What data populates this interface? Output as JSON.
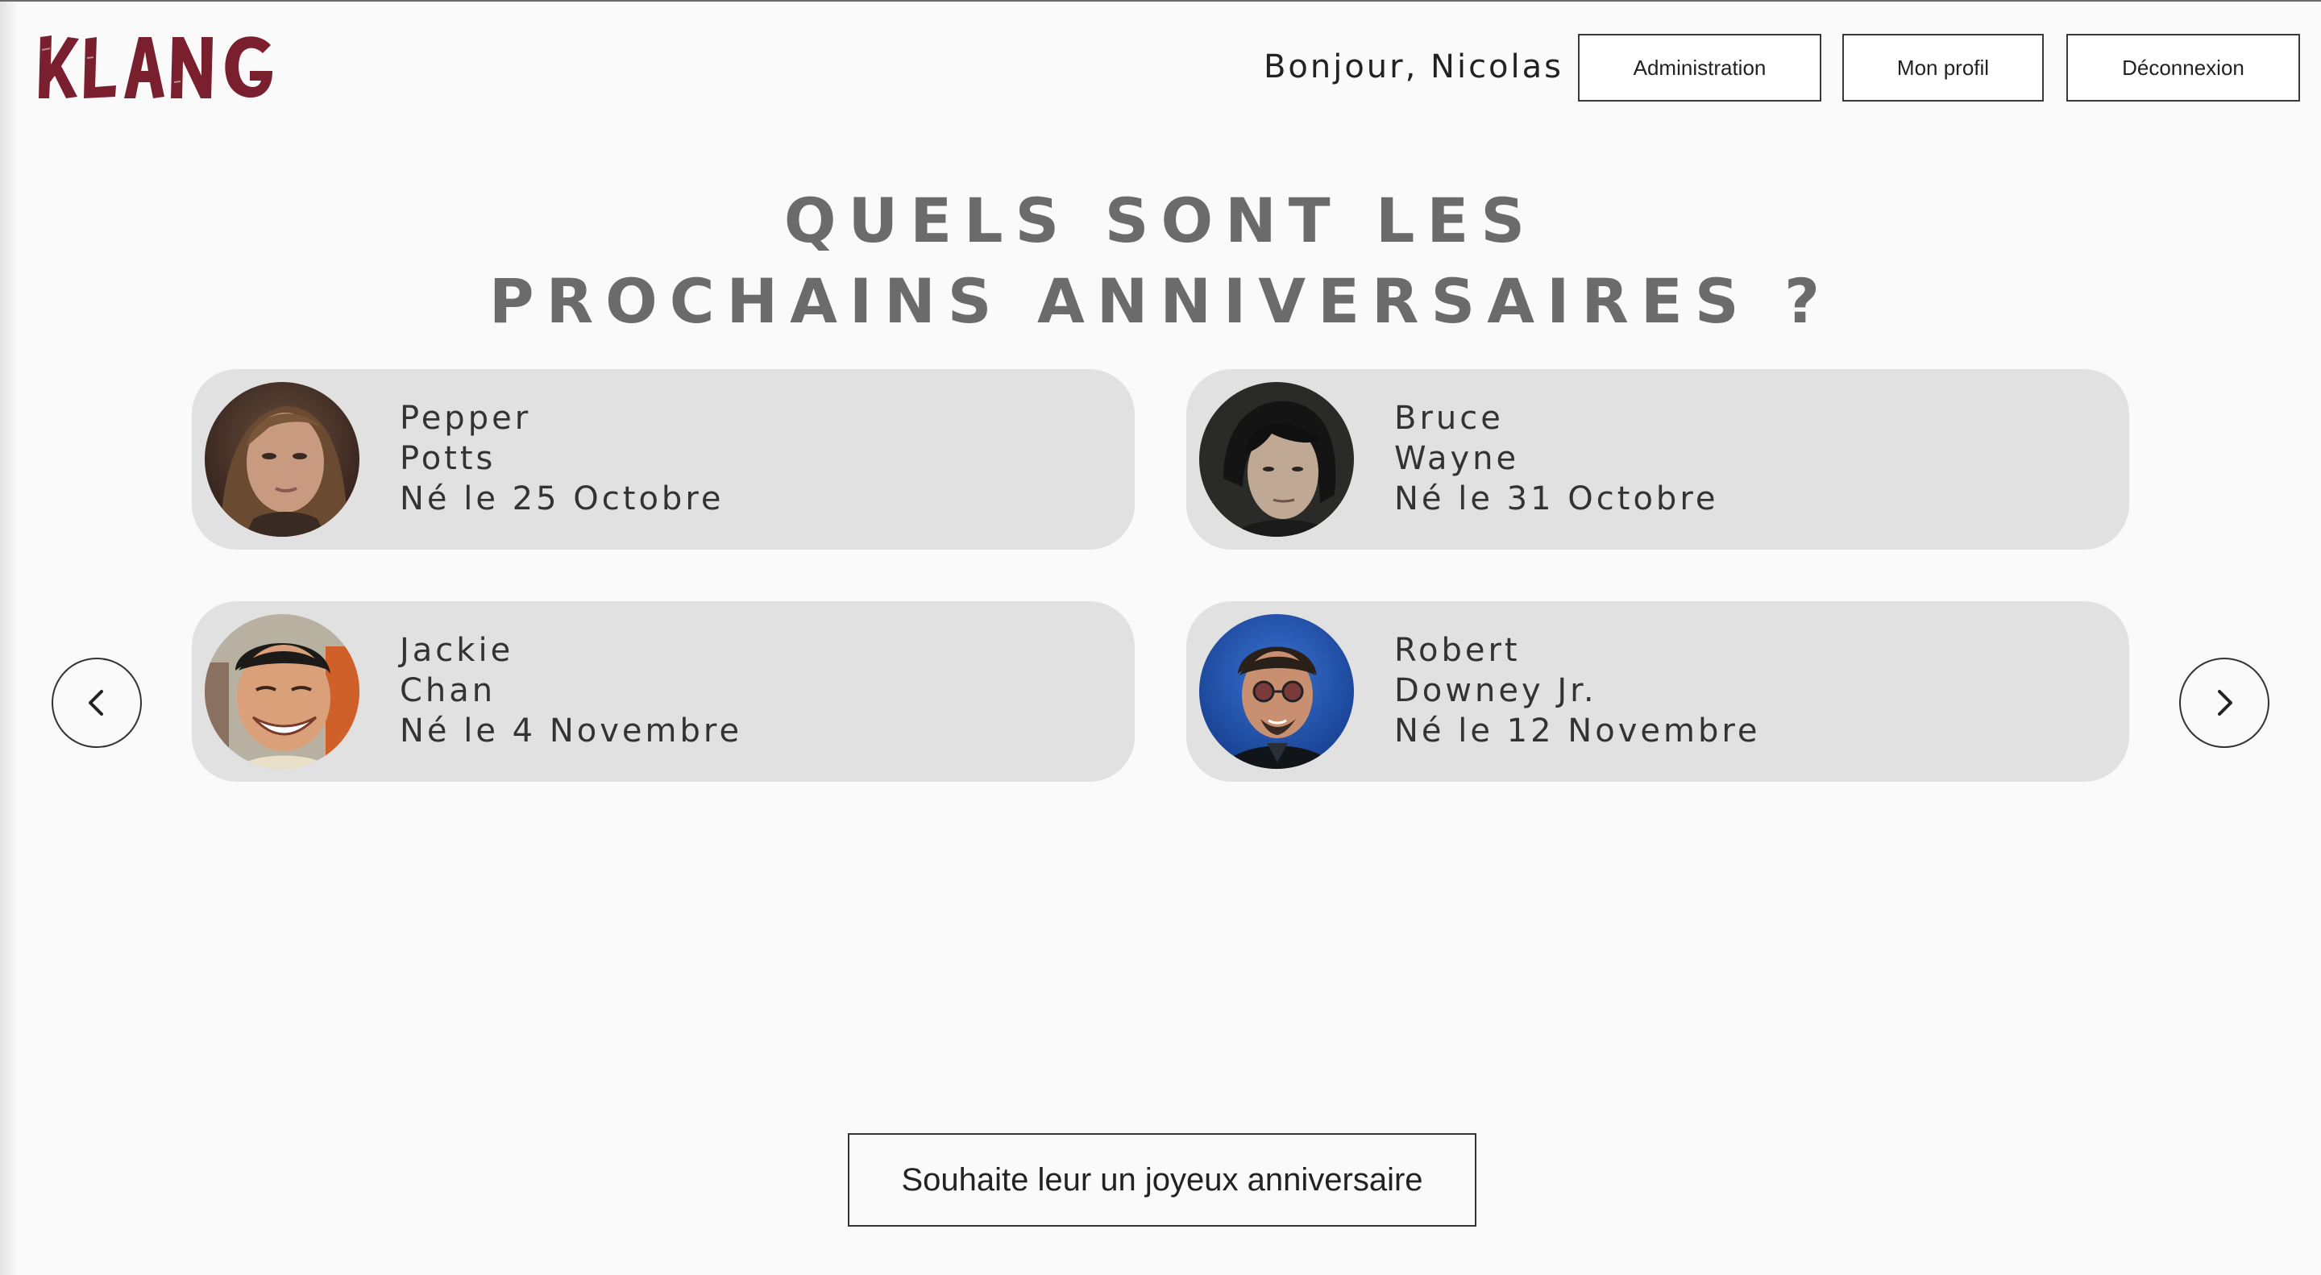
{
  "header": {
    "logo_text": "KLANG",
    "greeting": "Bonjour, Nicolas",
    "nav": {
      "admin_label": "Administration",
      "profile_label": "Mon profil",
      "logout_label": "Déconnexion"
    }
  },
  "main": {
    "title_line1": "QUELS SONT LES",
    "title_line2": "PROCHAINS ANNIVERSAIRES ?",
    "birthdays": [
      {
        "first_name": "Pepper",
        "last_name": "Potts",
        "date": "Né le 25 Octobre",
        "avatar": "portrait-pepper-potts"
      },
      {
        "first_name": "Bruce",
        "last_name": "Wayne",
        "date": "Né le 31 Octobre",
        "avatar": "portrait-bruce-wayne"
      },
      {
        "first_name": "Jackie",
        "last_name": "Chan",
        "date": "Né le 4 Novembre",
        "avatar": "portrait-jackie-chan"
      },
      {
        "first_name": "Robert",
        "last_name": "Downey Jr.",
        "date": "Né le 12 Novembre",
        "avatar": "portrait-robert-downey-jr"
      }
    ],
    "cta_label": "Souhaite leur un joyeux anniversaire"
  },
  "icons": {
    "prev": "chevron-left-icon",
    "next": "chevron-right-icon"
  },
  "colors": {
    "brand": "#7a1f2e",
    "background": "#fafafa",
    "card": "#e1e1e1",
    "title": "#6b6b6b"
  }
}
